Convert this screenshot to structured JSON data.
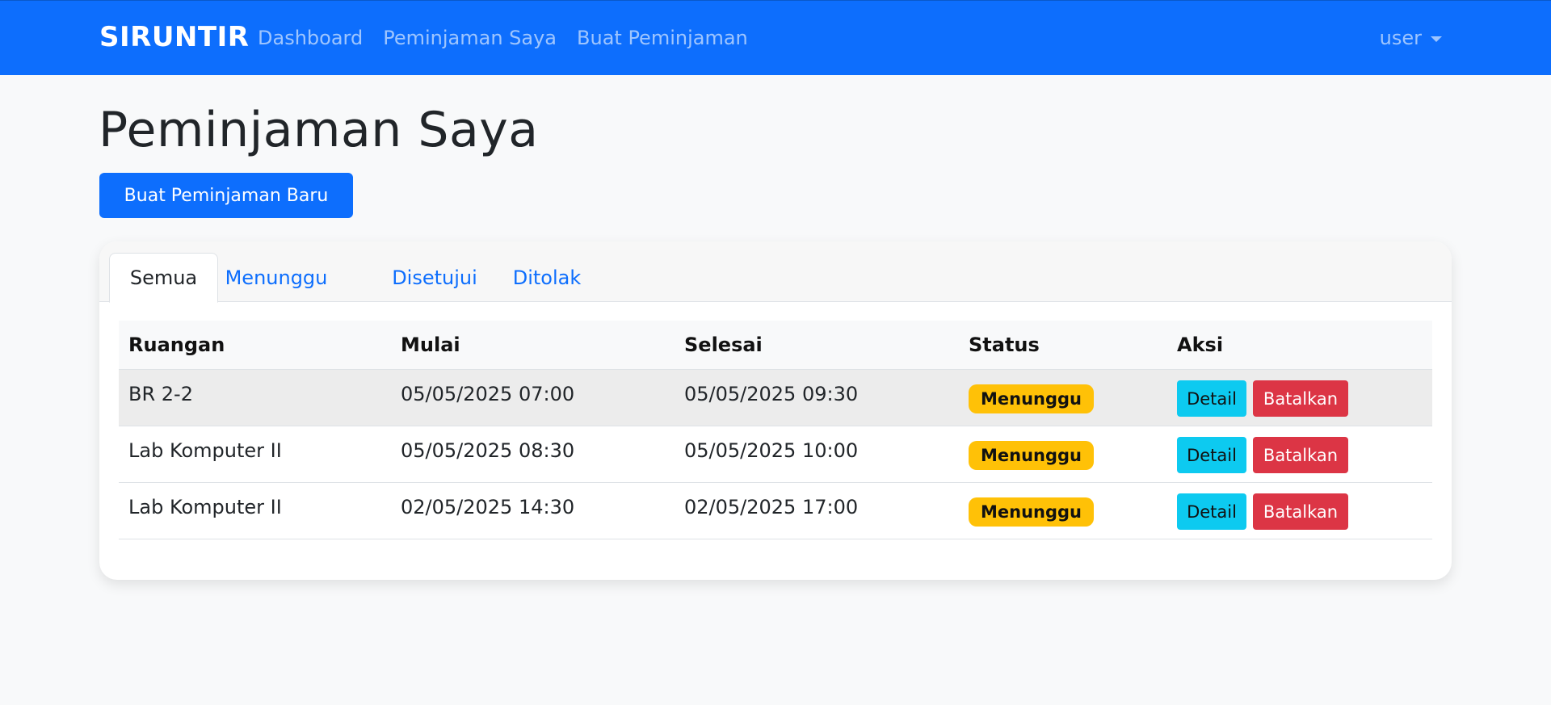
{
  "navbar": {
    "brand": "SIRUNTIR",
    "links": [
      "Dashboard",
      "Peminjaman Saya",
      "Buat Peminjaman"
    ],
    "user_label": "user"
  },
  "page": {
    "title": "Peminjaman Saya",
    "new_button_label": "Buat Peminjaman Baru"
  },
  "tabs": [
    {
      "label": "Semua",
      "active": true
    },
    {
      "label": "Menunggu",
      "active": false
    },
    {
      "label": "Disetujui",
      "active": false
    },
    {
      "label": "Ditolak",
      "active": false
    }
  ],
  "table": {
    "columns": [
      "Ruangan",
      "Mulai",
      "Selesai",
      "Status",
      "Aksi"
    ],
    "rows": [
      {
        "room": "BR 2-2",
        "start": "05/05/2025 07:00",
        "end": "05/05/2025 09:30",
        "status": "Menunggu",
        "detail": "Detail",
        "cancel": "Batalkan"
      },
      {
        "room": "Lab Komputer II",
        "start": "05/05/2025 08:30",
        "end": "05/05/2025 10:00",
        "status": "Menunggu",
        "detail": "Detail",
        "cancel": "Batalkan"
      },
      {
        "room": "Lab Komputer II",
        "start": "02/05/2025 14:30",
        "end": "02/05/2025 17:00",
        "status": "Menunggu",
        "detail": "Detail",
        "cancel": "Batalkan"
      }
    ]
  },
  "colors": {
    "primary": "#0d6efd",
    "warning": "#ffc107",
    "info": "#0dcaf0",
    "danger": "#dc3545",
    "background": "#f8f9fa"
  },
  "icons": {
    "user_menu": "caret-down-icon"
  }
}
